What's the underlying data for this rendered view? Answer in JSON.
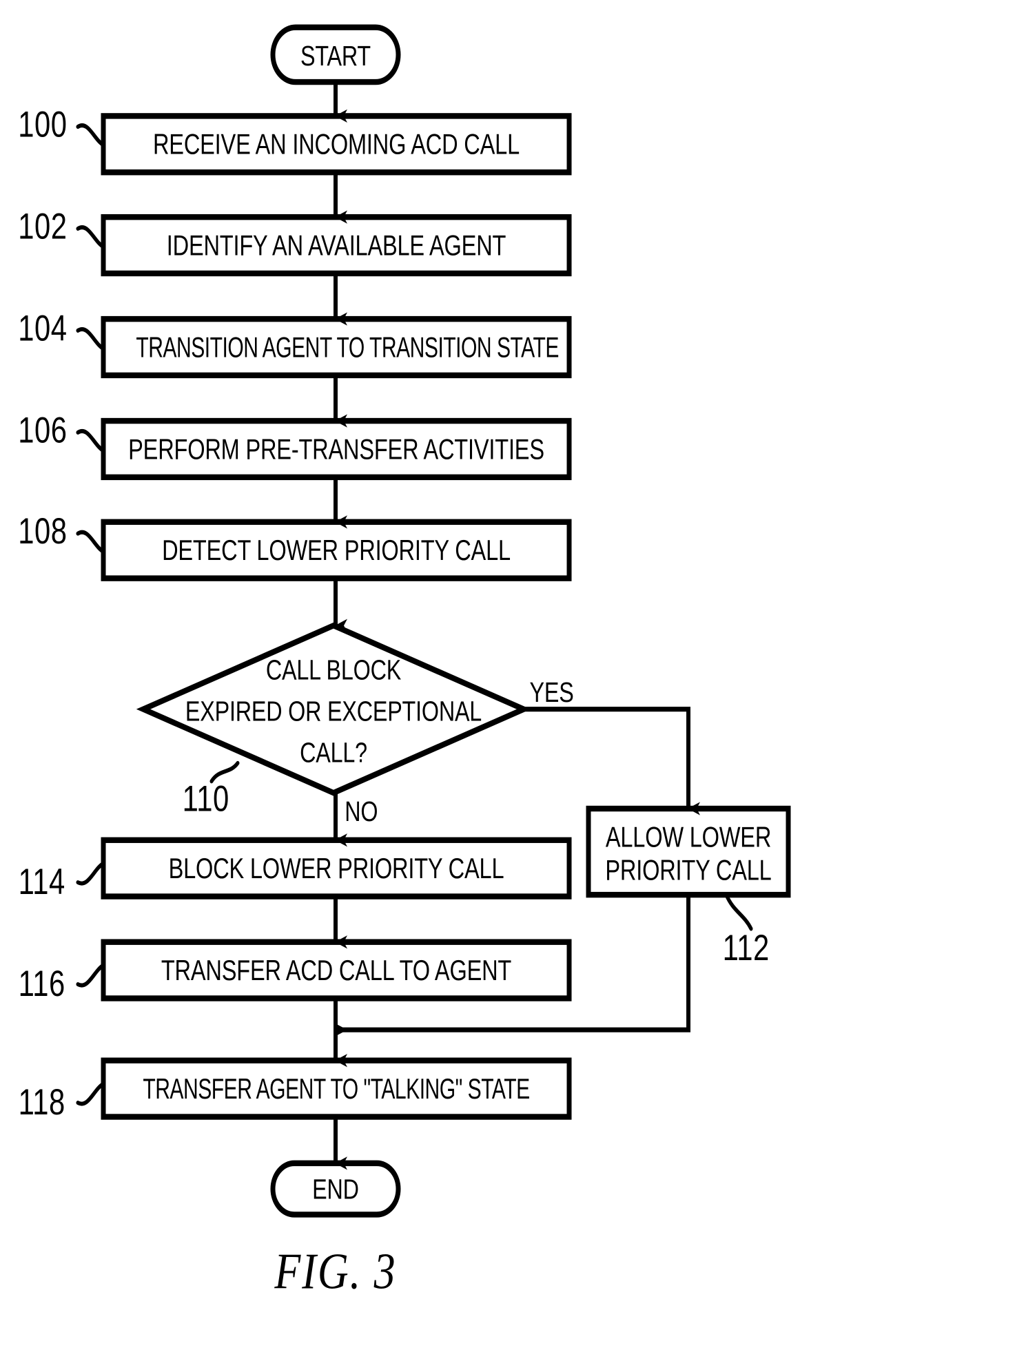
{
  "figure": {
    "caption": "FIG. 3",
    "type": "patent-flowchart"
  },
  "terminals": {
    "start": "START",
    "end": "END"
  },
  "steps": [
    {
      "ref": "100",
      "label": "RECEIVE AN INCOMING ACD CALL"
    },
    {
      "ref": "102",
      "label": "IDENTIFY AN AVAILABLE AGENT"
    },
    {
      "ref": "104",
      "label": "TRANSITION AGENT TO TRANSITION STATE"
    },
    {
      "ref": "106",
      "label": "PERFORM PRE-TRANSFER ACTIVITIES"
    },
    {
      "ref": "108",
      "label": "DETECT LOWER PRIORITY CALL"
    },
    {
      "ref": "114",
      "label": "BLOCK LOWER PRIORITY CALL"
    },
    {
      "ref": "116",
      "label": "TRANSFER ACD CALL TO AGENT"
    },
    {
      "ref": "118",
      "label": "TRANSFER AGENT TO \"TALKING\" STATE"
    }
  ],
  "decision": {
    "ref": "110",
    "line1": "CALL BLOCK",
    "line2": "EXPIRED OR EXCEPTIONAL",
    "line3": "CALL?",
    "branch_yes": "YES",
    "branch_no": "NO"
  },
  "side_step": {
    "ref": "112",
    "line1": "ALLOW LOWER",
    "line2": "PRIORITY CALL"
  },
  "colors": {
    "ink": "#000000",
    "paper": "#ffffff"
  }
}
